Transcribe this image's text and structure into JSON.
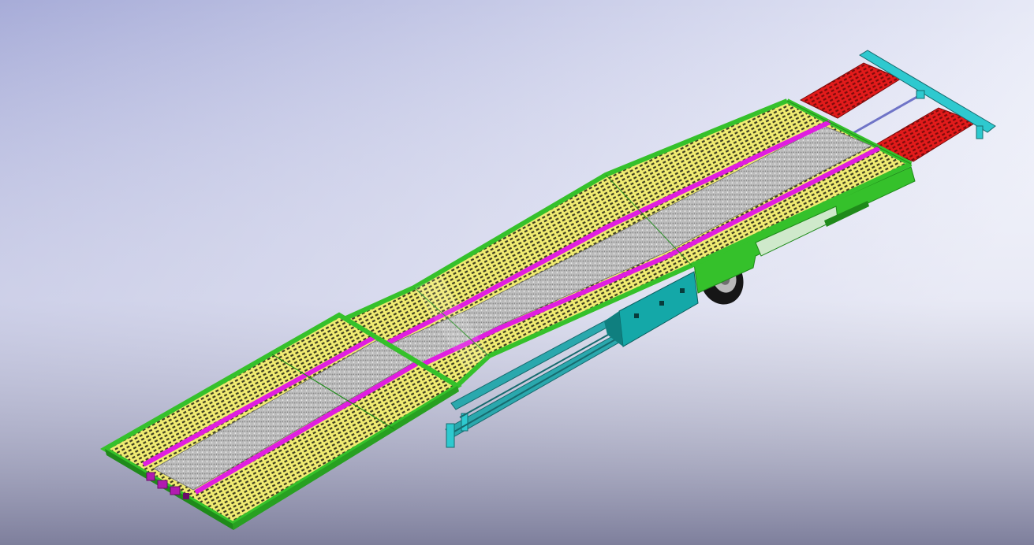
{
  "viewport": {
    "background_gradient": {
      "top_left": "#a7acd8",
      "top_right": "#eef0fa",
      "middle": "#e3e4f1",
      "bottom": "#7e7f9c"
    }
  },
  "model": {
    "colors": {
      "frame_green": "#35c12b",
      "frame_green_dark": "#1f8a1a",
      "deck_yellow": "#f1ec72",
      "deck_grid": "#3a3a20",
      "rail_magenta": "#e01ee0",
      "tread_grey": "#bdbdbd",
      "ramp_red": "#e21b1b",
      "crossbar_cyan": "#2ec9cf",
      "toolbox_teal": "#14a8a8",
      "tire_black": "#161616",
      "bumper_purple": "#b21bb0"
    }
  }
}
